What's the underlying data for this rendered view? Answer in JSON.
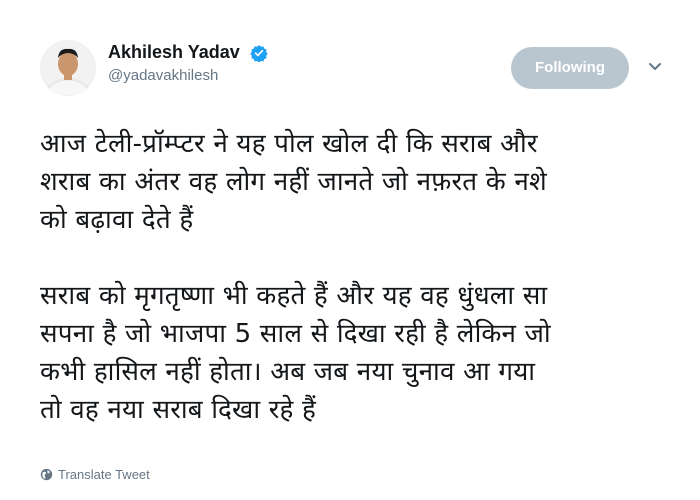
{
  "author": {
    "display_name": "Akhilesh Yadav",
    "handle": "@yadavakhilesh",
    "verified": true,
    "verified_color": "#1da1f2"
  },
  "actions": {
    "follow_label": "Following",
    "follow_color": "#b9c6d0",
    "menu_icon": "chevron-down-icon"
  },
  "tweet": {
    "paragraph1": [
      "आज टेली-प्रॉम्प्टर ने यह पोल खोल दी कि सराब और",
      "शराब का अंतर वह लोग नहीं जानते जो नफ़रत के नशे",
      "को बढ़ावा देते हैं"
    ],
    "paragraph2": [
      "सराब को मृगतृष्णा भी कहते हैं और यह वह धुंधला सा",
      "सपना है जो भाजपा 5 साल से दिखा रही है लेकिन जो",
      "कभी हासिल नहीं होता। अब जब नया चुनाव आ गया",
      "तो वह नया सराब दिखा रहे हैं"
    ]
  },
  "footer": {
    "translate_label": "Translate Tweet",
    "translate_icon": "globe-icon"
  }
}
